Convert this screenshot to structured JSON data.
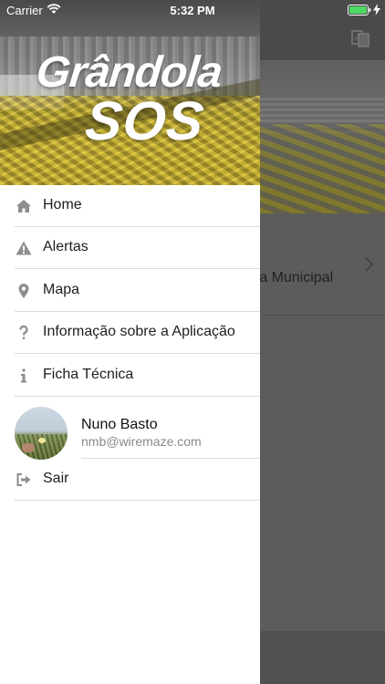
{
  "status_bar": {
    "carrier": "Carrier",
    "time": "5:32 PM",
    "battery_color": "#4cd964"
  },
  "drawer": {
    "logo": {
      "line1": "Grândola",
      "line2": "SOS"
    },
    "menu": [
      {
        "label": "Home",
        "icon": "home-icon"
      },
      {
        "label": "Alertas",
        "icon": "warning-icon"
      },
      {
        "label": "Mapa",
        "icon": "map-pin-icon"
      },
      {
        "label": "Informação sobre a Aplicação",
        "icon": "question-icon"
      },
      {
        "label": "Ficha Técnica",
        "icon": "info-icon"
      }
    ],
    "user": {
      "name": "Nuno Basto",
      "email": "nmb@wiremaze.com"
    },
    "logout": {
      "label": "Sair",
      "icon": "sign-out-icon"
    }
  },
  "background": {
    "list_item_text": "ara Municipal"
  }
}
